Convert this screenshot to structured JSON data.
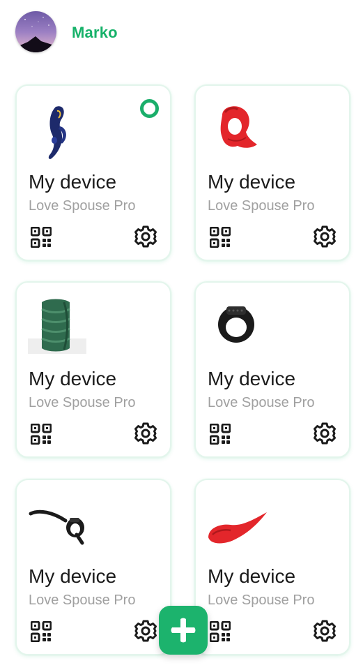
{
  "user": {
    "name": "Marko",
    "avatar_icon": "night-sky-mountain-avatar"
  },
  "colors": {
    "accent": "#1cb36d",
    "title": "#1b1b1b",
    "subtitle": "#a0a0a0"
  },
  "devices": [
    {
      "name": "My device",
      "model": "Love Spouse Pro",
      "image_icon": "blue-vibrator-icon",
      "connected": true
    },
    {
      "name": "My device",
      "model": "Love Spouse Pro",
      "image_icon": "red-ring-icon",
      "connected": false
    },
    {
      "name": "My device",
      "model": "Love Spouse Pro",
      "image_icon": "green-sleeve-icon",
      "connected": false
    },
    {
      "name": "My device",
      "model": "Love Spouse Pro",
      "image_icon": "black-ring-icon",
      "connected": false
    },
    {
      "name": "My device",
      "model": "Love Spouse Pro",
      "image_icon": "black-strap-ring-icon",
      "connected": false
    },
    {
      "name": "My device",
      "model": "Love Spouse Pro",
      "image_icon": "red-egg-icon",
      "connected": false
    }
  ],
  "icons": {
    "qr": "qr-code-icon",
    "settings": "gear-icon",
    "add": "plus-icon"
  }
}
